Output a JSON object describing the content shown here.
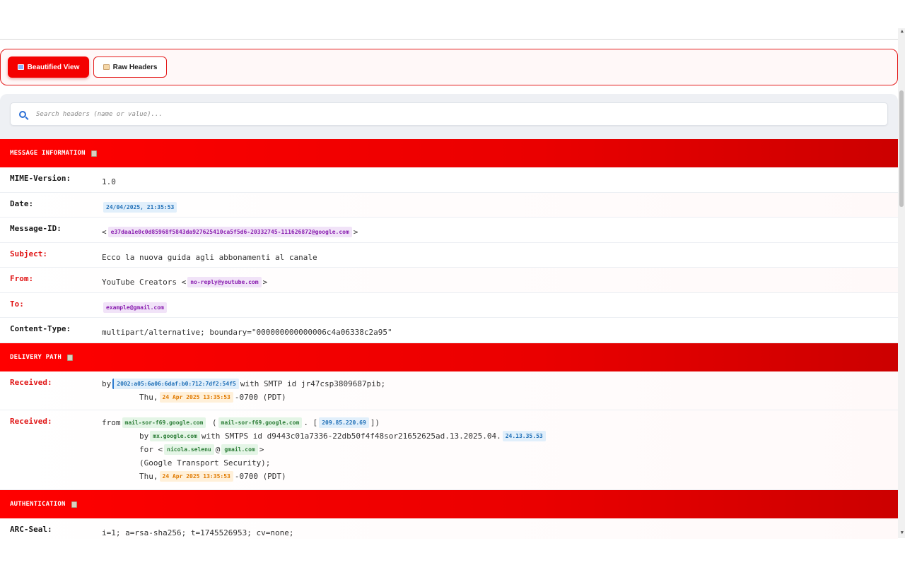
{
  "tabs": {
    "beautified": "Beautified View",
    "raw": "Raw Headers"
  },
  "search": {
    "placeholder": "Search headers (name or value)..."
  },
  "sections": {
    "message": {
      "title": "MESSAGE INFORMATION",
      "mime_name": "MIME-Version:",
      "mime_value": "1.0",
      "date_name": "Date:",
      "date_value": "24/04/2025, 21:35:53",
      "msgid_name": "Message-ID:",
      "msgid_value": "e37daa1e0c0d85968f5843da927625410ca5f5d6-20332745-111626872@google.com",
      "subject_name": "Subject:",
      "subject_value": "Ecco la nuova guida agli abbonamenti al canale",
      "from_name": "From:",
      "from_display": "YouTube Creators",
      "from_email": "no-reply@youtube.com",
      "to_name": "To:",
      "to_email": "example@gmail.com",
      "ctype_name": "Content-Type:",
      "ctype_value": "multipart/alternative; boundary=\"000000000000006c4a06338c2a95\""
    },
    "delivery": {
      "title": "DELIVERY PATH",
      "r1_name": "Received:",
      "r1_by": "by",
      "r1_ip": "2002:a05:6a06:6daf:b0:712:7df2:54f5",
      "r1_with": "with SMTP id jr47csp3809687pib;",
      "r1_thu": "Thu,",
      "r1_date": "24 Apr 2025 13:35:53",
      "r1_tz": "-0700 (PDT)",
      "r2_name": "Received:",
      "r2_from": "from",
      "r2_host1": "mail-sor-f69.google.com",
      "r2_host2": "mail-sor-f69.google.com",
      "r2_ip": "209.85.220.69",
      "r2_by": "by",
      "r2_mx": "mx.google.com",
      "r2_with": "with SMTPS id d9443c01a7336-22db50f4f48sor21652625ad.13.2025.04.",
      "r2_ver": "24.13.35.53",
      "r2_for": "for",
      "r2_user": "nicola.selenu",
      "r2_at": "@",
      "r2_domain": "gmail.com",
      "r2_tls": "(Google Transport Security);",
      "r2_thu": "Thu,",
      "r2_date": "24 Apr 2025 13:35:53",
      "r2_tz": "-0700 (PDT)"
    },
    "auth": {
      "title": "AUTHENTICATION",
      "arc_name": "ARC-Seal:",
      "arc_value": "i=1; a=rsa-sha256; t=1745526953; cv=none;"
    }
  },
  "colors": {
    "accent": "#f40000",
    "section_header": "#e60000",
    "highlight_name": "#e01515"
  }
}
